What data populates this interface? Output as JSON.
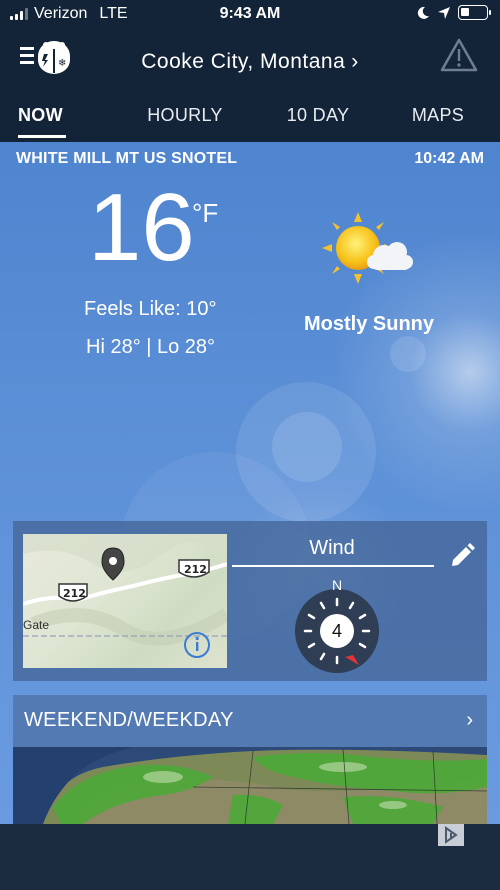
{
  "status_bar": {
    "carrier": "Verizon",
    "network": "LTE",
    "time": "9:43 AM"
  },
  "header": {
    "location": "Cooke City, Montana",
    "location_chevron": "›"
  },
  "tabs": [
    {
      "label": "NOW"
    },
    {
      "label": "HOURLY"
    },
    {
      "label": "10 DAY"
    },
    {
      "label": "MAPS"
    }
  ],
  "current": {
    "station": "WHITE MILL MT US SNOTEL",
    "observed_time": "10:42 AM",
    "temperature": "16",
    "unit": "°F",
    "feels_like": "Feels Like: 10°",
    "hi_lo": "Hi 28° | Lo 28°",
    "condition": "Mostly Sunny",
    "condition_icon": "sun-cloud-icon"
  },
  "wind_card": {
    "map": {
      "route_label_1": "212",
      "route_label_2": "212",
      "place_label": "Gate"
    },
    "title": "Wind",
    "compass_north": "N",
    "wind_speed": "4"
  },
  "weekend": {
    "title": "WEEKEND/WEEKDAY",
    "chevron": "›"
  },
  "colors": {
    "nav_bg": "#142438",
    "sky_top": "#4f84cf",
    "sky_bottom": "#6a9be0",
    "compass_pointer": "#e0343a"
  }
}
